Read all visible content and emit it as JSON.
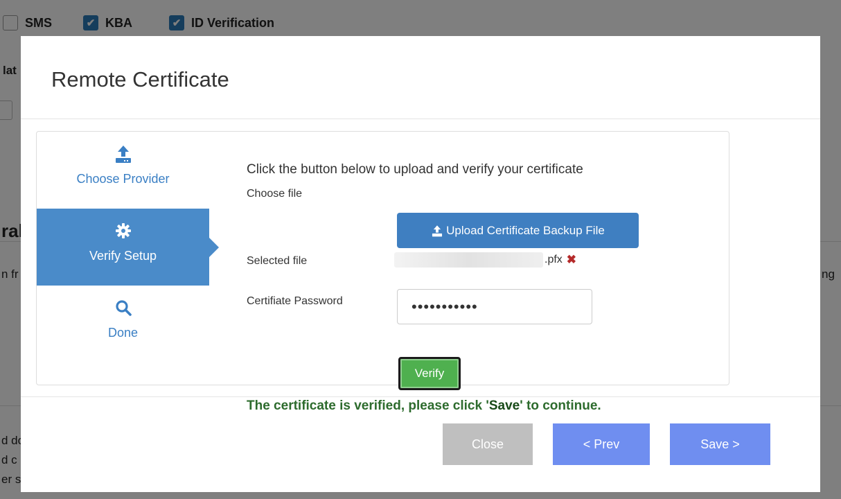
{
  "background": {
    "checkboxes": [
      {
        "label": "SMS",
        "checked": false
      },
      {
        "label": "KBA",
        "checked": true
      },
      {
        "label": "ID Verification",
        "checked": true
      }
    ],
    "fragments": [
      "lat",
      "ral",
      "n fr",
      "ng",
      "d do",
      "d c",
      "er s"
    ]
  },
  "modal": {
    "title": "Remote Certificate",
    "steps": [
      {
        "label": "Choose Provider",
        "icon": "upload-icon",
        "active": false
      },
      {
        "label": "Verify Setup",
        "icon": "gear-icon",
        "active": true
      },
      {
        "label": "Done",
        "icon": "search-icon",
        "active": false
      }
    ],
    "content": {
      "instruction": "Click the button below to upload and verify your certificate",
      "choose_file_label": "Choose file",
      "upload_button_label": "Upload Certificate Backup File",
      "selected_file_label": "Selected file",
      "selected_file_ext": ".pfx",
      "password_label": "Certifiate Password",
      "password_value": "•••••••••••",
      "verify_button_label": "Verify",
      "success_prefix": "The certificate is verified, please click '",
      "success_save": "Save",
      "success_suffix": "' to continue."
    },
    "footer": {
      "close_label": "Close",
      "prev_label": "< Prev",
      "save_label": "Save >"
    }
  },
  "colors": {
    "accent": "#4a8bc9",
    "success_text": "#2d6b2d",
    "verify_button": "#4fb04f",
    "footer_button": "#6f8ef0",
    "disabled_button": "#bfbfbf",
    "remove": "#b52a2a"
  }
}
